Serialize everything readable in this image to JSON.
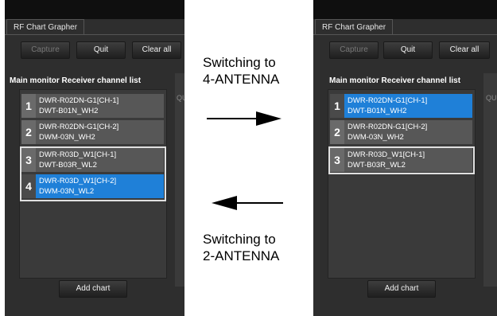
{
  "app": {
    "tab_title": "RF Chart Grapher"
  },
  "toolbar": {
    "capture": "Capture",
    "quit": "Quit",
    "clear_all": "Clear all"
  },
  "list": {
    "header": "Main monitor  Receiver channel list",
    "add_chart": "Add chart"
  },
  "side": {
    "label": "QU"
  },
  "left_panel": {
    "items": [
      {
        "num": "1",
        "line1": "DWR-R02DN-G1[CH-1]",
        "line2": "DWT-B01N_WH2"
      },
      {
        "num": "2",
        "line1": "DWR-R02DN-G1[CH-2]",
        "line2": "DWM-03N_WH2"
      },
      {
        "num": "3",
        "line1": "DWR-R03D_W1[CH-1]",
        "line2": "DWT-B03R_WL2"
      },
      {
        "num": "4",
        "line1": "DWR-R03D_W1[CH-2]",
        "line2": "DWM-03N_WL2"
      }
    ]
  },
  "right_panel": {
    "items": [
      {
        "num": "1",
        "line1": "DWR-R02DN-G1[CH-1]",
        "line2": "DWT-B01N_WH2"
      },
      {
        "num": "2",
        "line1": "DWR-R02DN-G1[CH-2]",
        "line2": "DWM-03N_WH2"
      },
      {
        "num": "3",
        "line1": "DWR-R03D_W1[CH-1]",
        "line2": "DWT-B03R_WL2"
      }
    ]
  },
  "captions": {
    "to4_line1": "Switching to",
    "to4_line2": "4-ANTENNA",
    "to2_line1": "Switching to",
    "to2_line2": "2-ANTENNA"
  }
}
